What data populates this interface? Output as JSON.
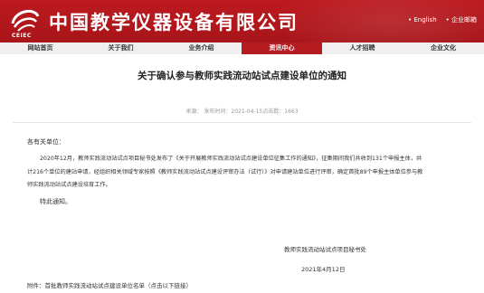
{
  "header": {
    "title": "中国教学仪器设备有限公司",
    "logo_text": "CEIEC",
    "links": [
      "• English",
      "• 企业邮箱"
    ]
  },
  "nav": {
    "items": [
      "网站首页",
      "关于我们",
      "业务介绍",
      "资讯中心",
      "人才招聘",
      "企业文化"
    ],
    "active_index": 3
  },
  "article": {
    "title": "关于确认参与教师实践流动站试点建设单位的通知",
    "meta": "来源：  发布时间：2021-04-15点击数：1663",
    "salutation": "各有关单位：",
    "para1_line1": "2020年12月，教师实践流动站试点项目秘书处发布了《关于开展教师实践流动站试点建设单位征集工作的通知》，征集期间我们共收到131个申报主体，共",
    "para1_line2": "计216个单位的建站申请，经组织相关领域专家按照《教师实践流动站试点建设评审办法（试行）》对申请建站单位进行评审，确定首批89个申报主体单位参与教",
    "para1_line3": "师实践流动站试点建设培育工作。",
    "closing": "特此通知。",
    "signature": "教师实践流动站试点项目秘书处",
    "date": "2021年4月12日",
    "attachment": "附件：首批教师实践流动站试点建设单位名单（点击以下链接）"
  },
  "colors": {
    "brand_red": "#b41c1f",
    "nav_bg": "#f0eeee"
  }
}
